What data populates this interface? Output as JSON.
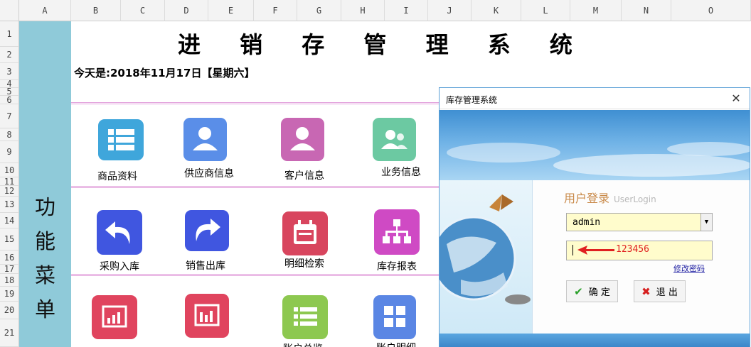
{
  "sheet": {
    "columns": [
      "A",
      "B",
      "C",
      "D",
      "E",
      "F",
      "G",
      "H",
      "I",
      "J",
      "K",
      "L",
      "M",
      "N",
      "O"
    ],
    "rows": [
      "1",
      "2",
      "3",
      "4",
      "5",
      "6",
      "7",
      "8",
      "9",
      "10",
      "11",
      "12",
      "13",
      "14",
      "15",
      "16",
      "17",
      "18",
      "19",
      "20",
      "21"
    ]
  },
  "title": "进 销 存 管 理 系 统",
  "today": "今天是:2018年11月17日【星期六】",
  "menu_label": [
    "功",
    "能",
    "菜",
    "单"
  ],
  "tiles_row1": [
    {
      "label": "商品资料",
      "icon": "list-icon",
      "color": "#3fa6db"
    },
    {
      "label": "供应商信息",
      "icon": "person-icon",
      "color": "#5a8ee8"
    },
    {
      "label": "客户信息",
      "icon": "person-icon",
      "color": "#c867b3"
    },
    {
      "label": "业务信息",
      "icon": "group-icon",
      "color": "#6cc9a2"
    }
  ],
  "tiles_row2": [
    {
      "label": "采购入库",
      "icon": "undo-arrow-icon",
      "color": "#4056e0"
    },
    {
      "label": "销售出库",
      "icon": "redo-arrow-icon",
      "color": "#4056e0"
    },
    {
      "label": "明细检索",
      "icon": "calendar-icon",
      "color": "#d8455e"
    },
    {
      "label": "库存报表",
      "icon": "org-chart-icon",
      "color": "#cf4ac4"
    }
  ],
  "tiles_row3": [
    {
      "label": "",
      "icon": "bar-chart-icon",
      "color": "#e0445e"
    },
    {
      "label": "",
      "icon": "bar-chart-icon",
      "color": "#e0445e"
    },
    {
      "label": "账户总览",
      "icon": "list-icon",
      "color": "#8dc850"
    },
    {
      "label": "账户明细",
      "icon": "grid-icon",
      "color": "#5a86e4"
    }
  ],
  "dialog": {
    "title": "库存管理系统",
    "heading": "用户登录",
    "heading_en": "UserLogin",
    "username": "admin",
    "password_hint": "123456",
    "change_password": "修改密码",
    "ok_label": "确 定",
    "exit_label": "退 出"
  }
}
